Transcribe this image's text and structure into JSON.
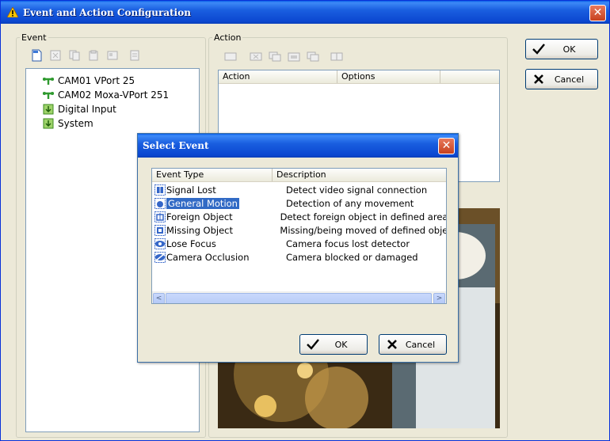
{
  "window": {
    "title": "Event and Action Configuration",
    "close_glyph": "✕"
  },
  "event_group": {
    "label": "Event",
    "tree": [
      {
        "label": "CAM01 VPort 25",
        "icon": "camera-icon"
      },
      {
        "label": "CAM02 Moxa-VPort 251",
        "icon": "camera-icon"
      },
      {
        "label": "Digital Input",
        "icon": "digital-input-icon"
      },
      {
        "label": "System",
        "icon": "system-icon"
      }
    ]
  },
  "action_group": {
    "label": "Action",
    "columns": [
      "Action",
      "Options"
    ]
  },
  "buttons": {
    "ok": "OK",
    "cancel": "Cancel"
  },
  "dialog": {
    "title": "Select Event",
    "close_glyph": "✕",
    "columns": [
      "Event Type",
      "Description"
    ],
    "rows": [
      {
        "type": "Signal Lost",
        "description": "Detect video signal connection"
      },
      {
        "type": "General Motion",
        "description": "Detection of any movement"
      },
      {
        "type": "Foreign Object",
        "description": "Detect foreign object in defined area(s"
      },
      {
        "type": "Missing Object",
        "description": "Missing/being moved of defined object"
      },
      {
        "type": "Lose Focus",
        "description": "Camera focus lost detector"
      },
      {
        "type": "Camera Occlusion",
        "description": "Camera blocked or damaged"
      }
    ],
    "selected_index": 1,
    "scroll_left": "<",
    "scroll_right": ">",
    "ok": "OK",
    "cancel": "Cancel"
  },
  "colors": {
    "titlebar": "#0b47d0",
    "selection": "#316ac5",
    "face": "#ece9d8"
  }
}
